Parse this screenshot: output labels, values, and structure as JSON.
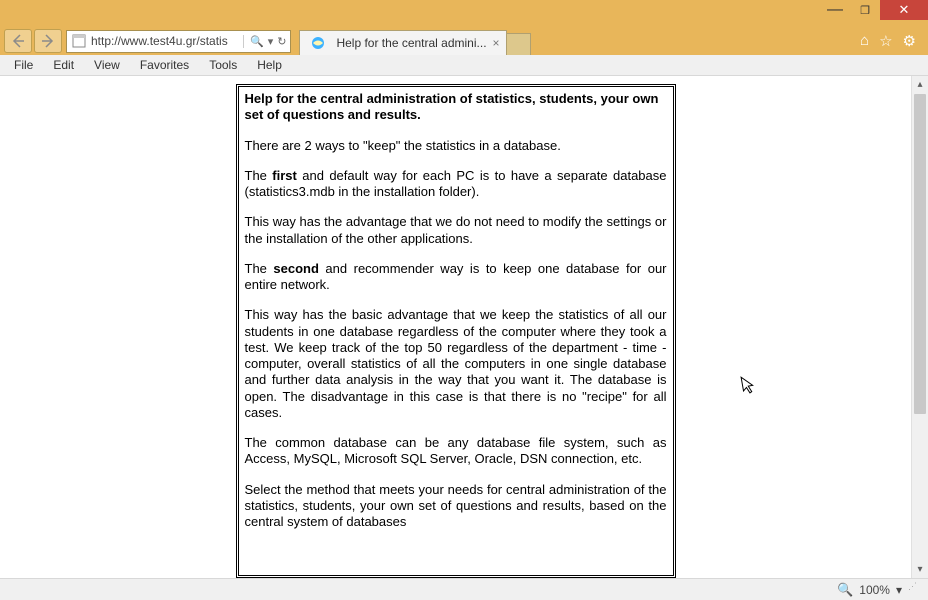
{
  "window": {
    "minimize": "—",
    "maximize": "❐",
    "close": "✕"
  },
  "nav": {
    "back": "←",
    "forward": "→",
    "url": "http://www.test4u.gr/statis",
    "search_glyph": "🔍",
    "dropdown_glyph": "▾",
    "refresh_glyph": "↻"
  },
  "tab": {
    "title": "Help for the central admini...",
    "close": "×"
  },
  "icons": {
    "home": "⌂",
    "star": "☆",
    "gear": "⚙"
  },
  "menu": {
    "file": "File",
    "edit": "Edit",
    "view": "View",
    "favorites": "Favorites",
    "tools": "Tools",
    "help": "Help"
  },
  "content": {
    "heading": "Help for the central administration of statistics, students, your own set of questions and results.",
    "p1": "There are 2 ways to \"keep\" the statistics in a database.",
    "p2a": "The ",
    "p2b": "first",
    "p2c": " and default way for each PC is to have a separate database (statistics3.mdb in the installation folder).",
    "p3": "This way  has the advantage that we do not need to modify the settings or the installation of the other applications.",
    "p4a": "The ",
    "p4b": "second",
    "p4c": " and recommender way is to keep one database for our entire network.",
    "p5": "This way has the basic advantage that we keep the statistics of all our students in one database regardless of the computer where they took a test. We keep track of the top 50 regardless of the department - time - computer, overall statistics of all the computers in one single database and further data analysis in the way that you want it. The database is open. The disadvantage in this case is that there is no \"recipe\" for all cases.",
    "p6": "The common database can be any database file system, such as Access, MySQL, Microsoft SQL Server, Oracle, DSN connection, etc.",
    "p7": "Select the method that meets your needs for central administration of the statistics, students, your own set of questions and results, based on the central system of databases"
  },
  "status": {
    "zoom": "100%",
    "dropdown": "▾"
  }
}
